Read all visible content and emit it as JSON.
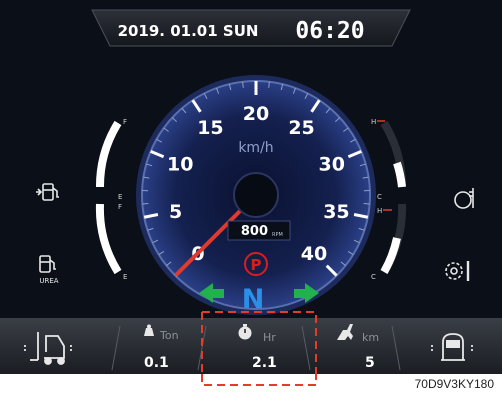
{
  "header": {
    "date": "2019. 01.01 SUN",
    "time": "06:20"
  },
  "speedometer": {
    "unit": "km/h",
    "ticks": [
      "0",
      "5",
      "10",
      "15",
      "20",
      "25",
      "30",
      "35",
      "40"
    ],
    "rpm_value": "800",
    "rpm_unit": "RPM",
    "speed": 0
  },
  "indicators": {
    "parking": "P",
    "gear": "N"
  },
  "left_gauges": {
    "fuel": {
      "full_mark": "F",
      "empty_mark": "E",
      "level": 0.9
    },
    "urea": {
      "full_mark": "F",
      "empty_mark": "E",
      "label": "UREA",
      "level": 0.85
    }
  },
  "right_gauges": {
    "coolant": {
      "hot_mark": "H",
      "cold_mark": "C",
      "level": 0.3
    },
    "oil": {
      "hot_mark": "H",
      "cold_mark": "C",
      "level": 0.35
    }
  },
  "bottom_bar": {
    "load": {
      "label": "Ton",
      "value": "0.1"
    },
    "hours": {
      "label": "Hr",
      "value": "2.1"
    },
    "distance": {
      "label": "km",
      "value": "5"
    }
  },
  "figure_code": "70D9V3KY180",
  "colors": {
    "background": "#0b1018",
    "gear_blue": "#2b8fe8",
    "arrow_green": "#22b14c",
    "needle": "#e03a2f",
    "parking_red": "#d81e1e",
    "highlight_dash": "#e53b2a"
  }
}
